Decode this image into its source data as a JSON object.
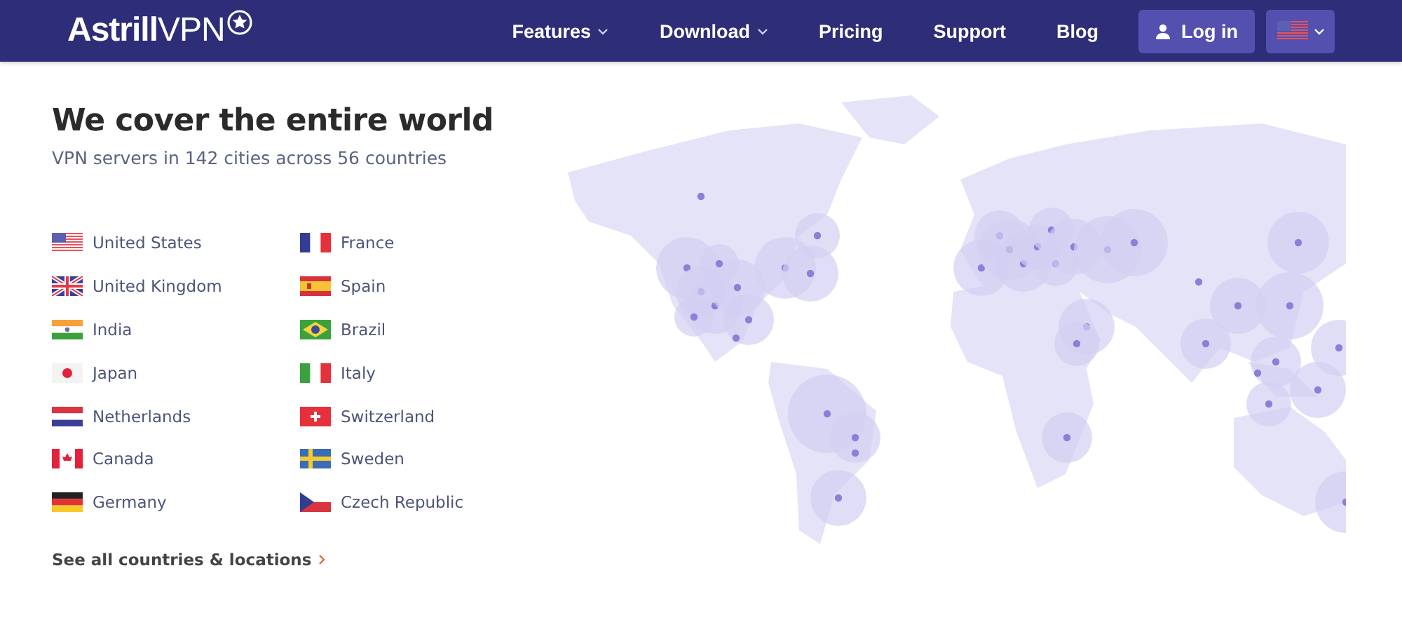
{
  "header": {
    "logo": "**Astrill**VPN",
    "nav": [
      {
        "label": "Features",
        "has_menu": true
      },
      {
        "label": "Download",
        "has_menu": true
      },
      {
        "label": "Pricing",
        "has_menu": false
      },
      {
        "label": "Support",
        "has_menu": false
      },
      {
        "label": "Blog",
        "has_menu": false
      }
    ],
    "login": "Log in"
  },
  "hero": {
    "title": "We cover the entire world",
    "subtitle": "VPN servers in 142 cities across 56 countries"
  },
  "countries": [
    {
      "name": "United States",
      "kind": "us"
    },
    {
      "name": "United Kingdom",
      "kind": "uk"
    },
    {
      "name": "India",
      "kind": "in"
    },
    {
      "name": "Japan",
      "kind": "jp"
    },
    {
      "name": "Netherlands",
      "kind": "nl"
    },
    {
      "name": "Canada",
      "kind": "ca"
    },
    {
      "name": "Germany",
      "kind": "de"
    },
    {
      "name": "France",
      "kind": "fr"
    },
    {
      "name": "Spain",
      "kind": "es"
    },
    {
      "name": "Brazil",
      "kind": "br"
    },
    {
      "name": "Italy",
      "kind": "it"
    },
    {
      "name": "Switzerland",
      "kind": "ch"
    },
    {
      "name": "Sweden",
      "kind": "se"
    },
    {
      "name": "Czech Republic",
      "kind": "cz"
    }
  ],
  "see_all": "See all countries & locations"
}
